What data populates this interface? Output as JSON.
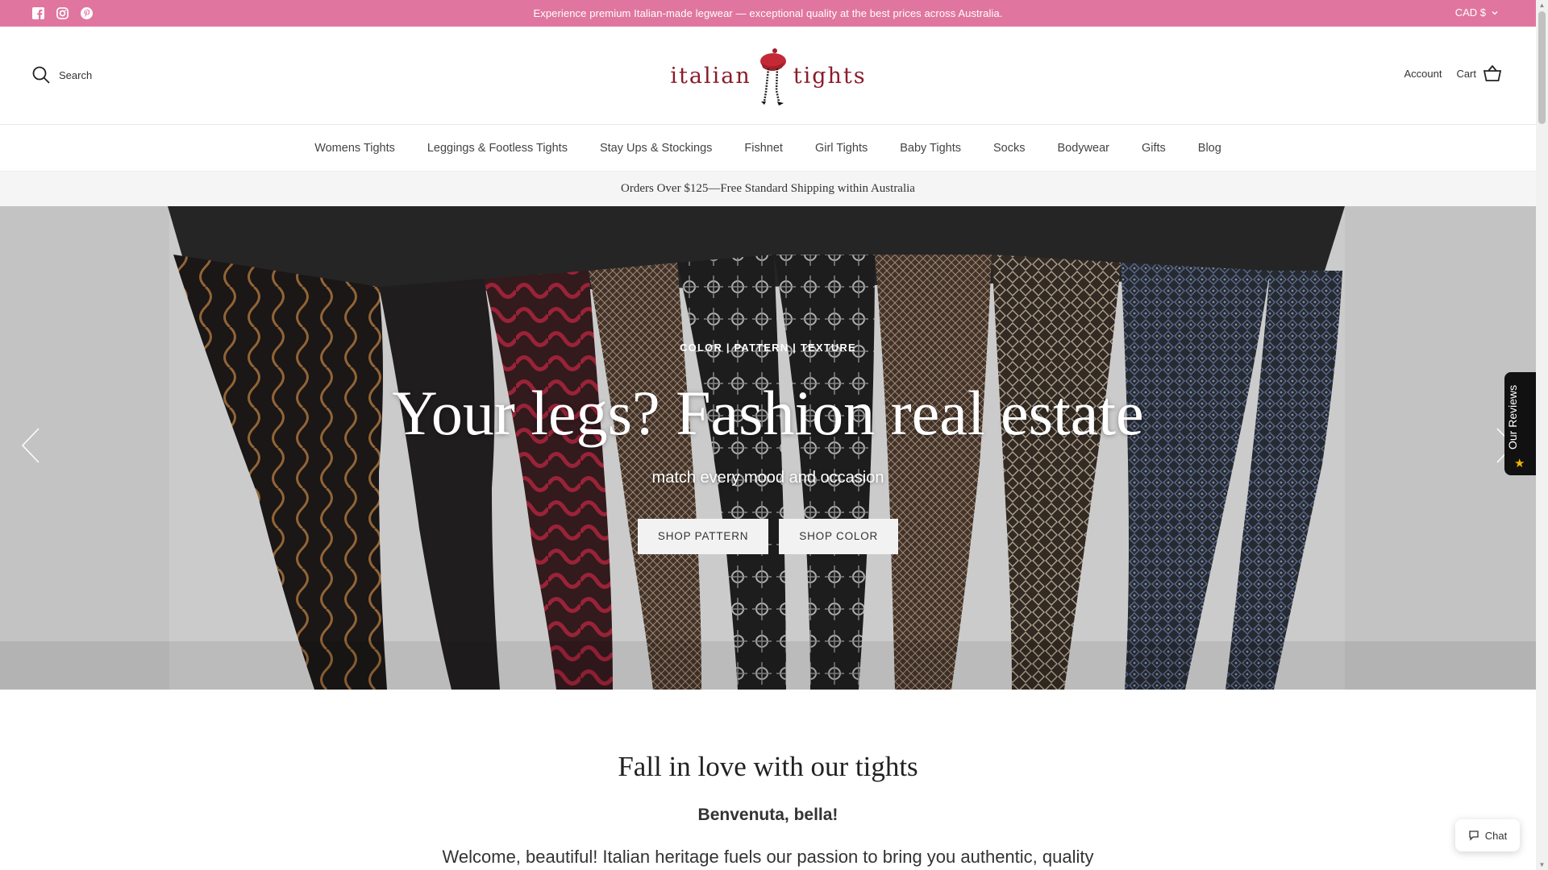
{
  "announcement": {
    "message": "Experience premium Italian-made legwear — exceptional quality at the best prices across Australia.",
    "currency": "CAD $",
    "socials": [
      "facebook-icon",
      "instagram-icon",
      "pinterest-icon"
    ]
  },
  "header": {
    "search_label": "Search",
    "logo_left": "italian",
    "logo_right": "tights",
    "account_label": "Account",
    "cart_label": "Cart"
  },
  "nav": {
    "items": [
      {
        "label": "Womens Tights"
      },
      {
        "label": "Leggings & Footless Tights"
      },
      {
        "label": "Stay Ups & Stockings"
      },
      {
        "label": "Fishnet"
      },
      {
        "label": "Girl Tights"
      },
      {
        "label": "Baby Tights"
      },
      {
        "label": "Socks"
      },
      {
        "label": "Bodywear"
      },
      {
        "label": "Gifts"
      },
      {
        "label": "Blog"
      }
    ]
  },
  "shipping_bar": "Orders Over $125—Free Standard Shipping within Australia",
  "hero": {
    "kicker": "COLOR | PATTERN | TEXTURE",
    "headline": "Your legs? Fashion real estate",
    "subheadline": "match every mood and occasion",
    "buttons": [
      {
        "label": "SHOP PATTERN"
      },
      {
        "label": "SHOP COLOR"
      }
    ]
  },
  "reviews_tab": "Our Reviews",
  "intro": {
    "title": "Fall in love with our tights",
    "subtitle": "Benvenuta, bella!",
    "body": "Welcome, beautiful! Italian heritage fuels our passion to bring you authentic, quality"
  },
  "chat_label": "Chat",
  "colors": {
    "announcement_bg": "#e0769f",
    "brand_red": "#8c1b2a",
    "shipping_bar_bg": "#f5f5f5"
  }
}
